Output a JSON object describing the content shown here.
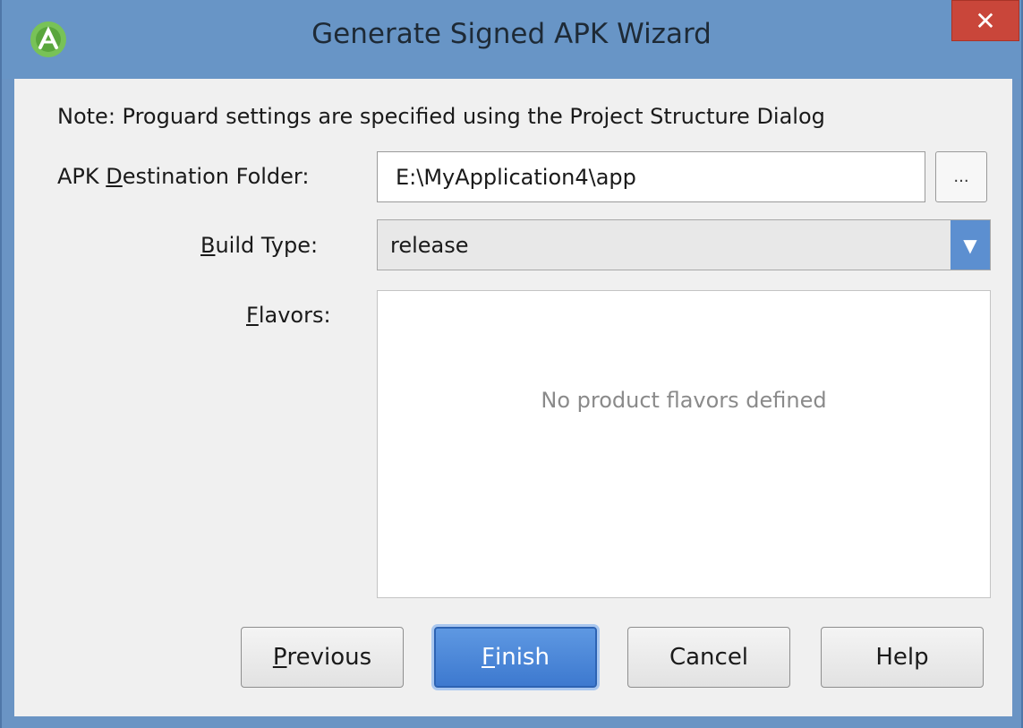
{
  "window": {
    "title": "Generate Signed APK Wizard",
    "close_glyph": "✕",
    "icon": "android-studio-icon"
  },
  "note": "Note: Proguard settings are specified using the Project Structure Dialog",
  "form": {
    "destination": {
      "label_pre": "APK ",
      "label_mnemonic": "D",
      "label_post": "estination Folder:",
      "value": "E:\\MyApplication4\\app",
      "browse_label": "..."
    },
    "build_type": {
      "label_mnemonic": "B",
      "label_post": "uild Type:",
      "value": "release",
      "arrow_glyph": "▼"
    },
    "flavors": {
      "label_mnemonic": "F",
      "label_post": "lavors:",
      "empty_text": "No product flavors defined"
    }
  },
  "buttons": {
    "previous": {
      "mnemonic": "P",
      "rest": "revious"
    },
    "finish": {
      "mnemonic": "F",
      "rest": "inish"
    },
    "cancel": {
      "label": "Cancel"
    },
    "help": {
      "label": "Help"
    }
  },
  "colors": {
    "titlebar": "#6895c6",
    "close": "#c9463a",
    "primary": "#3d79cf",
    "dropdown_arrow": "#5c8fd0"
  }
}
